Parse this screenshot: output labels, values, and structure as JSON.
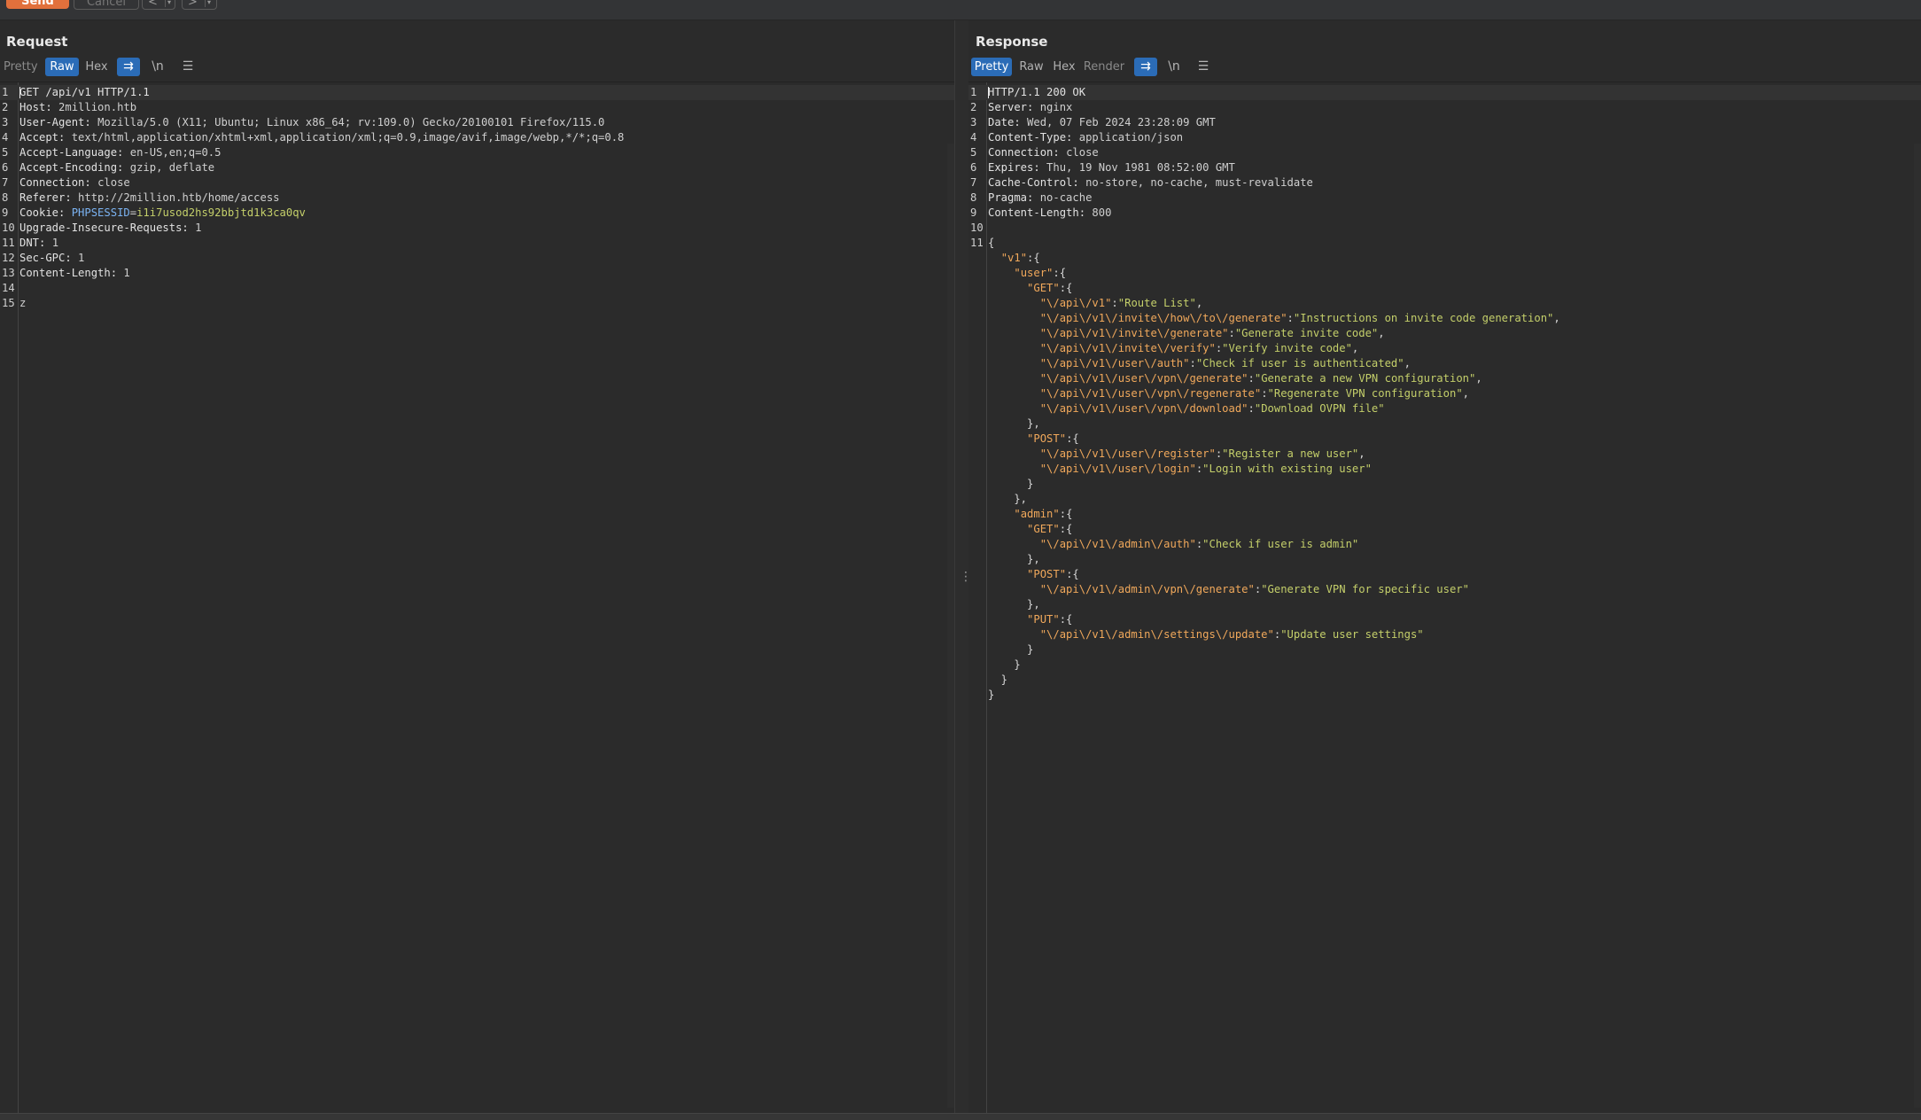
{
  "toolbar": {
    "send_label": "Send",
    "cancel_label": "Cancel",
    "back_glyph": "<",
    "forward_glyph": ">",
    "dropdown_glyph": "▾"
  },
  "request": {
    "title": "Request",
    "tabs": [
      {
        "label": "Pretty",
        "active": false
      },
      {
        "label": "Raw",
        "active": true
      },
      {
        "label": "Hex",
        "active": false
      }
    ],
    "icons": [
      {
        "name": "wrap-lines-icon",
        "glyph": "⇉",
        "active": true
      },
      {
        "name": "newline-icon",
        "glyph": "\\n",
        "active": false
      },
      {
        "name": "menu-icon",
        "glyph": "☰",
        "active": false
      }
    ],
    "lines": [
      {
        "n": "1",
        "parts": [
          {
            "t": "GET /api/v1 HTTP/1.1",
            "c": "k"
          }
        ]
      },
      {
        "n": "2",
        "parts": [
          {
            "t": "Host: ",
            "c": "k"
          },
          {
            "t": "2million.htb",
            "c": "v"
          }
        ]
      },
      {
        "n": "3",
        "parts": [
          {
            "t": "User-Agent: ",
            "c": "k"
          },
          {
            "t": "Mozilla/5.0 (X11; Ubuntu; Linux x86_64; rv:109.0) Gecko/20100101 Firefox/115.0",
            "c": "v"
          }
        ]
      },
      {
        "n": "4",
        "parts": [
          {
            "t": "Accept: ",
            "c": "k"
          },
          {
            "t": "text/html,application/xhtml+xml,application/xml;q=0.9,image/avif,image/webp,*/*;q=0.8",
            "c": "v"
          }
        ]
      },
      {
        "n": "5",
        "parts": [
          {
            "t": "Accept-Language: ",
            "c": "k"
          },
          {
            "t": "en-US,en;q=0.5",
            "c": "v"
          }
        ]
      },
      {
        "n": "6",
        "parts": [
          {
            "t": "Accept-Encoding: ",
            "c": "k"
          },
          {
            "t": "gzip, deflate",
            "c": "v"
          }
        ]
      },
      {
        "n": "7",
        "parts": [
          {
            "t": "Connection: ",
            "c": "k"
          },
          {
            "t": "close",
            "c": "v"
          }
        ]
      },
      {
        "n": "8",
        "parts": [
          {
            "t": "Referer: ",
            "c": "k"
          },
          {
            "t": "http://2million.htb/home/access",
            "c": "v"
          }
        ]
      },
      {
        "n": "9",
        "parts": [
          {
            "t": "Cookie: ",
            "c": "k"
          },
          {
            "t": "PHPSESSID",
            "c": "ck"
          },
          {
            "t": "=",
            "c": "v"
          },
          {
            "t": "i1i7usod2hs92bbjtd1k3ca0qv",
            "c": "cv"
          }
        ]
      },
      {
        "n": "10",
        "parts": [
          {
            "t": "Upgrade-Insecure-Requests: ",
            "c": "k"
          },
          {
            "t": "1",
            "c": "v"
          }
        ]
      },
      {
        "n": "11",
        "parts": [
          {
            "t": "DNT: ",
            "c": "k"
          },
          {
            "t": "1",
            "c": "v"
          }
        ]
      },
      {
        "n": "12",
        "parts": [
          {
            "t": "Sec-GPC: ",
            "c": "k"
          },
          {
            "t": "1",
            "c": "v"
          }
        ]
      },
      {
        "n": "13",
        "parts": [
          {
            "t": "Content-Length: ",
            "c": "k"
          },
          {
            "t": "1",
            "c": "v"
          }
        ]
      },
      {
        "n": "14",
        "parts": []
      },
      {
        "n": "15",
        "parts": [
          {
            "t": "z",
            "c": "v"
          }
        ]
      }
    ]
  },
  "response": {
    "title": "Response",
    "tabs": [
      {
        "label": "Pretty",
        "active": true
      },
      {
        "label": "Raw",
        "active": false
      },
      {
        "label": "Hex",
        "active": false
      },
      {
        "label": "Render",
        "active": false
      }
    ],
    "icons": [
      {
        "name": "wrap-lines-icon",
        "glyph": "⇉",
        "active": true
      },
      {
        "name": "newline-icon",
        "glyph": "\\n",
        "active": false
      },
      {
        "name": "menu-icon",
        "glyph": "☰",
        "active": false
      }
    ],
    "lines": [
      {
        "n": "1",
        "parts": [
          {
            "t": "HTTP/1.1 200 OK",
            "c": "k"
          }
        ]
      },
      {
        "n": "2",
        "parts": [
          {
            "t": "Server: ",
            "c": "k"
          },
          {
            "t": "nginx",
            "c": "v"
          }
        ]
      },
      {
        "n": "3",
        "parts": [
          {
            "t": "Date: ",
            "c": "k"
          },
          {
            "t": "Wed, 07 Feb 2024 23:28:09 GMT",
            "c": "v"
          }
        ]
      },
      {
        "n": "4",
        "parts": [
          {
            "t": "Content-Type: ",
            "c": "k"
          },
          {
            "t": "application/json",
            "c": "v"
          }
        ]
      },
      {
        "n": "5",
        "parts": [
          {
            "t": "Connection: ",
            "c": "k"
          },
          {
            "t": "close",
            "c": "v"
          }
        ]
      },
      {
        "n": "6",
        "parts": [
          {
            "t": "Expires: ",
            "c": "k"
          },
          {
            "t": "Thu, 19 Nov 1981 08:52:00 GMT",
            "c": "v"
          }
        ]
      },
      {
        "n": "7",
        "parts": [
          {
            "t": "Cache-Control: ",
            "c": "k"
          },
          {
            "t": "no-store, no-cache, must-revalidate",
            "c": "v"
          }
        ]
      },
      {
        "n": "8",
        "parts": [
          {
            "t": "Pragma: ",
            "c": "k"
          },
          {
            "t": "no-cache",
            "c": "v"
          }
        ]
      },
      {
        "n": "9",
        "parts": [
          {
            "t": "Content-Length: ",
            "c": "k"
          },
          {
            "t": "800",
            "c": "v"
          }
        ]
      },
      {
        "n": "10",
        "parts": []
      },
      {
        "n": "11",
        "parts": [
          {
            "t": "{",
            "c": "jp"
          }
        ]
      },
      {
        "n": "",
        "parts": [
          {
            "t": "  ",
            "c": "jp"
          },
          {
            "t": "\"v1\"",
            "c": "jk"
          },
          {
            "t": ":{",
            "c": "jp"
          }
        ]
      },
      {
        "n": "",
        "parts": [
          {
            "t": "    ",
            "c": "jp"
          },
          {
            "t": "\"user\"",
            "c": "jk"
          },
          {
            "t": ":{",
            "c": "jp"
          }
        ]
      },
      {
        "n": "",
        "parts": [
          {
            "t": "      ",
            "c": "jp"
          },
          {
            "t": "\"GET\"",
            "c": "jk"
          },
          {
            "t": ":{",
            "c": "jp"
          }
        ]
      },
      {
        "n": "",
        "parts": [
          {
            "t": "        ",
            "c": "jp"
          },
          {
            "t": "\"\\/api\\/v1\"",
            "c": "jk"
          },
          {
            "t": ":",
            "c": "jp"
          },
          {
            "t": "\"Route List\"",
            "c": "js"
          },
          {
            "t": ",",
            "c": "jp"
          }
        ]
      },
      {
        "n": "",
        "parts": [
          {
            "t": "        ",
            "c": "jp"
          },
          {
            "t": "\"\\/api\\/v1\\/invite\\/how\\/to\\/generate\"",
            "c": "jk"
          },
          {
            "t": ":",
            "c": "jp"
          },
          {
            "t": "\"Instructions on invite code generation\"",
            "c": "js"
          },
          {
            "t": ",",
            "c": "jp"
          }
        ]
      },
      {
        "n": "",
        "parts": [
          {
            "t": "        ",
            "c": "jp"
          },
          {
            "t": "\"\\/api\\/v1\\/invite\\/generate\"",
            "c": "jk"
          },
          {
            "t": ":",
            "c": "jp"
          },
          {
            "t": "\"Generate invite code\"",
            "c": "js"
          },
          {
            "t": ",",
            "c": "jp"
          }
        ]
      },
      {
        "n": "",
        "parts": [
          {
            "t": "        ",
            "c": "jp"
          },
          {
            "t": "\"\\/api\\/v1\\/invite\\/verify\"",
            "c": "jk"
          },
          {
            "t": ":",
            "c": "jp"
          },
          {
            "t": "\"Verify invite code\"",
            "c": "js"
          },
          {
            "t": ",",
            "c": "jp"
          }
        ]
      },
      {
        "n": "",
        "parts": [
          {
            "t": "        ",
            "c": "jp"
          },
          {
            "t": "\"\\/api\\/v1\\/user\\/auth\"",
            "c": "jk"
          },
          {
            "t": ":",
            "c": "jp"
          },
          {
            "t": "\"Check if user is authenticated\"",
            "c": "js"
          },
          {
            "t": ",",
            "c": "jp"
          }
        ]
      },
      {
        "n": "",
        "parts": [
          {
            "t": "        ",
            "c": "jp"
          },
          {
            "t": "\"\\/api\\/v1\\/user\\/vpn\\/generate\"",
            "c": "jk"
          },
          {
            "t": ":",
            "c": "jp"
          },
          {
            "t": "\"Generate a new VPN configuration\"",
            "c": "js"
          },
          {
            "t": ",",
            "c": "jp"
          }
        ]
      },
      {
        "n": "",
        "parts": [
          {
            "t": "        ",
            "c": "jp"
          },
          {
            "t": "\"\\/api\\/v1\\/user\\/vpn\\/regenerate\"",
            "c": "jk"
          },
          {
            "t": ":",
            "c": "jp"
          },
          {
            "t": "\"Regenerate VPN configuration\"",
            "c": "js"
          },
          {
            "t": ",",
            "c": "jp"
          }
        ]
      },
      {
        "n": "",
        "parts": [
          {
            "t": "        ",
            "c": "jp"
          },
          {
            "t": "\"\\/api\\/v1\\/user\\/vpn\\/download\"",
            "c": "jk"
          },
          {
            "t": ":",
            "c": "jp"
          },
          {
            "t": "\"Download OVPN file\"",
            "c": "js"
          }
        ]
      },
      {
        "n": "",
        "parts": [
          {
            "t": "      },",
            "c": "jp"
          }
        ]
      },
      {
        "n": "",
        "parts": [
          {
            "t": "      ",
            "c": "jp"
          },
          {
            "t": "\"POST\"",
            "c": "jk"
          },
          {
            "t": ":{",
            "c": "jp"
          }
        ]
      },
      {
        "n": "",
        "parts": [
          {
            "t": "        ",
            "c": "jp"
          },
          {
            "t": "\"\\/api\\/v1\\/user\\/register\"",
            "c": "jk"
          },
          {
            "t": ":",
            "c": "jp"
          },
          {
            "t": "\"Register a new user\"",
            "c": "js"
          },
          {
            "t": ",",
            "c": "jp"
          }
        ]
      },
      {
        "n": "",
        "parts": [
          {
            "t": "        ",
            "c": "jp"
          },
          {
            "t": "\"\\/api\\/v1\\/user\\/login\"",
            "c": "jk"
          },
          {
            "t": ":",
            "c": "jp"
          },
          {
            "t": "\"Login with existing user\"",
            "c": "js"
          }
        ]
      },
      {
        "n": "",
        "parts": [
          {
            "t": "      }",
            "c": "jp"
          }
        ]
      },
      {
        "n": "",
        "parts": [
          {
            "t": "    },",
            "c": "jp"
          }
        ]
      },
      {
        "n": "",
        "parts": [
          {
            "t": "    ",
            "c": "jp"
          },
          {
            "t": "\"admin\"",
            "c": "jk"
          },
          {
            "t": ":{",
            "c": "jp"
          }
        ]
      },
      {
        "n": "",
        "parts": [
          {
            "t": "      ",
            "c": "jp"
          },
          {
            "t": "\"GET\"",
            "c": "jk"
          },
          {
            "t": ":{",
            "c": "jp"
          }
        ]
      },
      {
        "n": "",
        "parts": [
          {
            "t": "        ",
            "c": "jp"
          },
          {
            "t": "\"\\/api\\/v1\\/admin\\/auth\"",
            "c": "jk"
          },
          {
            "t": ":",
            "c": "jp"
          },
          {
            "t": "\"Check if user is admin\"",
            "c": "js"
          }
        ]
      },
      {
        "n": "",
        "parts": [
          {
            "t": "      },",
            "c": "jp"
          }
        ]
      },
      {
        "n": "",
        "parts": [
          {
            "t": "      ",
            "c": "jp"
          },
          {
            "t": "\"POST\"",
            "c": "jk"
          },
          {
            "t": ":{",
            "c": "jp"
          }
        ]
      },
      {
        "n": "",
        "parts": [
          {
            "t": "        ",
            "c": "jp"
          },
          {
            "t": "\"\\/api\\/v1\\/admin\\/vpn\\/generate\"",
            "c": "jk"
          },
          {
            "t": ":",
            "c": "jp"
          },
          {
            "t": "\"Generate VPN for specific user\"",
            "c": "js"
          }
        ]
      },
      {
        "n": "",
        "parts": [
          {
            "t": "      },",
            "c": "jp"
          }
        ]
      },
      {
        "n": "",
        "parts": [
          {
            "t": "      ",
            "c": "jp"
          },
          {
            "t": "\"PUT\"",
            "c": "jk"
          },
          {
            "t": ":{",
            "c": "jp"
          }
        ]
      },
      {
        "n": "",
        "parts": [
          {
            "t": "        ",
            "c": "jp"
          },
          {
            "t": "\"\\/api\\/v1\\/admin\\/settings\\/update\"",
            "c": "jk"
          },
          {
            "t": ":",
            "c": "jp"
          },
          {
            "t": "\"Update user settings\"",
            "c": "js"
          }
        ]
      },
      {
        "n": "",
        "parts": [
          {
            "t": "      }",
            "c": "jp"
          }
        ]
      },
      {
        "n": "",
        "parts": [
          {
            "t": "    }",
            "c": "jp"
          }
        ]
      },
      {
        "n": "",
        "parts": [
          {
            "t": "  }",
            "c": "jp"
          }
        ]
      },
      {
        "n": "",
        "parts": [
          {
            "t": "}",
            "c": "jp"
          }
        ]
      }
    ]
  },
  "layout_buttons": [
    {
      "name": "layout-side-by-side-icon",
      "active": true
    },
    {
      "name": "layout-stacked-icon",
      "active": false
    },
    {
      "name": "layout-tabs-icon",
      "active": false
    }
  ],
  "colors": {
    "accent": "#2b6cb7",
    "send": "#e1703c",
    "json_key": "#f0a85b",
    "json_string": "#c4cf6a",
    "cookie_name": "#7bb3f2"
  }
}
